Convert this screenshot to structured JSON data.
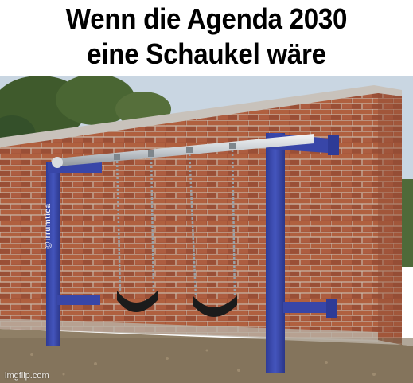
{
  "caption": {
    "line1": "Wenn die Agenda 2030",
    "line2": "eine Schaukel wäre"
  },
  "photo": {
    "description_icon": "swing-set-against-brick-wall-photo",
    "watermark_post": "@irrumtica",
    "watermark_site": "imgflip.com"
  },
  "colors": {
    "caption_text": "#000000",
    "background": "#ffffff",
    "brick": "#a4553a",
    "frame_blue": "#3846a8",
    "sky": "#c9d6e2"
  }
}
